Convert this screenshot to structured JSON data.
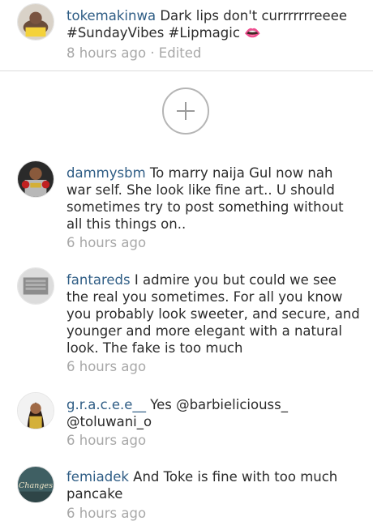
{
  "comments": [
    {
      "username": "tokemakinwa",
      "text": "Dark lips don't currrrrrreeee #SundayVibes #Lipmagic",
      "emoji": "👄",
      "time": "8 hours ago",
      "edited": "· Edited",
      "avatar_icon": "avatar-photo-woman"
    },
    {
      "username": "dammysbm",
      "text": "To marry naija Gul now nah war self. She look like fine art.. U should sometimes try to post something without all this things on..",
      "time": "6 hours ago",
      "avatar_icon": "avatar-photo-boxer"
    },
    {
      "username": "fantareds",
      "text": "I admire you but could we see the real you sometimes. For all you know you probably look sweeter, and secure, and younger and more elegant with a natural look.  The fake is too much",
      "time": "6 hours ago",
      "avatar_icon": "avatar-photo-device"
    },
    {
      "username": "g.r.a.c.e.e__",
      "text": "Yes @barbieliciouss_ @toluwani_o",
      "time": "6 hours ago",
      "avatar_icon": "avatar-photo-woman"
    },
    {
      "username": "femiadek",
      "text": "And Toke is fine with too much pancake",
      "time": "6 hours ago",
      "avatar_icon": "avatar-photo-changes",
      "avatar_text": "Changes"
    }
  ],
  "load_more_icon": "plus-icon"
}
